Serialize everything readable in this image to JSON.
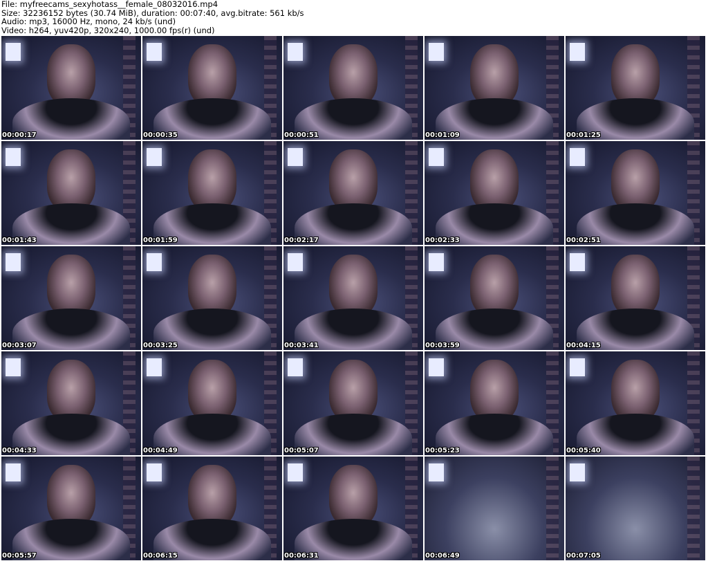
{
  "header": {
    "file": "File: myfreecams_sexyhotass__female_08032016.mp4",
    "size": "Size: 32236152 bytes (30.74 MiB), duration: 00:07:40, avg.bitrate: 561 kb/s",
    "audio": "Audio: mp3, 16000 Hz, mono, 24 kb/s (und)",
    "video": "Video: h264, yuv420p, 320x240, 1000.00 fps(r) (und)"
  },
  "thumbnails": [
    "00:00:17",
    "00:00:35",
    "00:00:51",
    "00:01:09",
    "00:01:25",
    "00:01:43",
    "00:01:59",
    "00:02:17",
    "00:02:33",
    "00:02:51",
    "00:03:07",
    "00:03:25",
    "00:03:41",
    "00:03:59",
    "00:04:15",
    "00:04:33",
    "00:04:49",
    "00:05:07",
    "00:05:23",
    "00:05:40",
    "00:05:57",
    "00:06:15",
    "00:06:31",
    "00:06:49",
    "00:07:05"
  ]
}
